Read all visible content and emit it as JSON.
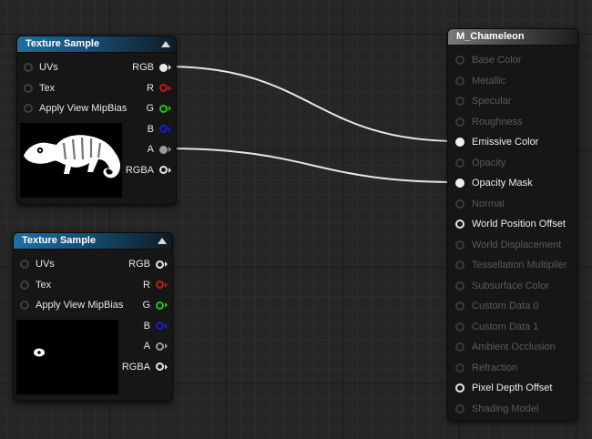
{
  "texture_nodes": [
    {
      "title": "Texture Sample",
      "inputs": [
        "UVs",
        "Tex",
        "Apply View MipBias"
      ],
      "outputs": [
        {
          "label": "RGB",
          "color": "#e8e8e8",
          "connected": true
        },
        {
          "label": "R",
          "color": "#d01818",
          "connected": false
        },
        {
          "label": "G",
          "color": "#18c818",
          "connected": false
        },
        {
          "label": "B",
          "color": "#1a1ae0",
          "connected": false
        },
        {
          "label": "A",
          "color": "#9a9a9a",
          "connected": true
        },
        {
          "label": "RGBA",
          "color": "#e8e8e8",
          "connected": false
        }
      ],
      "preview": "chameleon-silhouette"
    },
    {
      "title": "Texture Sample",
      "inputs": [
        "UVs",
        "Tex",
        "Apply View MipBias"
      ],
      "outputs": [
        {
          "label": "RGB",
          "color": "#e8e8e8",
          "connected": false
        },
        {
          "label": "R",
          "color": "#d01818",
          "connected": false
        },
        {
          "label": "G",
          "color": "#18c818",
          "connected": false
        },
        {
          "label": "B",
          "color": "#1a1ae0",
          "connected": false
        },
        {
          "label": "A",
          "color": "#9a9a9a",
          "connected": false
        },
        {
          "label": "RGBA",
          "color": "#e8e8e8",
          "connected": false
        }
      ],
      "preview": "eye-mask"
    }
  ],
  "material_node": {
    "title": "M_Chameleon",
    "inputs": [
      {
        "label": "Base Color",
        "state": "disabled"
      },
      {
        "label": "Metallic",
        "state": "disabled"
      },
      {
        "label": "Specular",
        "state": "disabled"
      },
      {
        "label": "Roughness",
        "state": "disabled"
      },
      {
        "label": "Emissive Color",
        "state": "connected"
      },
      {
        "label": "Opacity",
        "state": "disabled"
      },
      {
        "label": "Opacity Mask",
        "state": "connected"
      },
      {
        "label": "Normal",
        "state": "disabled"
      },
      {
        "label": "World Position Offset",
        "state": "enabled"
      },
      {
        "label": "World Displacement",
        "state": "disabled"
      },
      {
        "label": "Tessellation Multiplier",
        "state": "disabled"
      },
      {
        "label": "Subsurface Color",
        "state": "disabled"
      },
      {
        "label": "Custom Data 0",
        "state": "disabled"
      },
      {
        "label": "Custom Data 1",
        "state": "disabled"
      },
      {
        "label": "Ambient Occlusion",
        "state": "disabled"
      },
      {
        "label": "Refraction",
        "state": "disabled"
      },
      {
        "label": "Pixel Depth Offset",
        "state": "enabled"
      },
      {
        "label": "Shading Model",
        "state": "disabled"
      }
    ]
  },
  "connections": [
    {
      "from_node": 0,
      "from_output": "RGB",
      "to_input": "Emissive Color"
    },
    {
      "from_node": 0,
      "from_output": "A",
      "to_input": "Opacity Mask"
    }
  ],
  "colors": {
    "graph_background": "#262626",
    "texture_header": "#1e6fa0",
    "material_header": "#7a7a7a",
    "wire": "#e6e6e6",
    "disabled_text": "#5a5a5a"
  }
}
